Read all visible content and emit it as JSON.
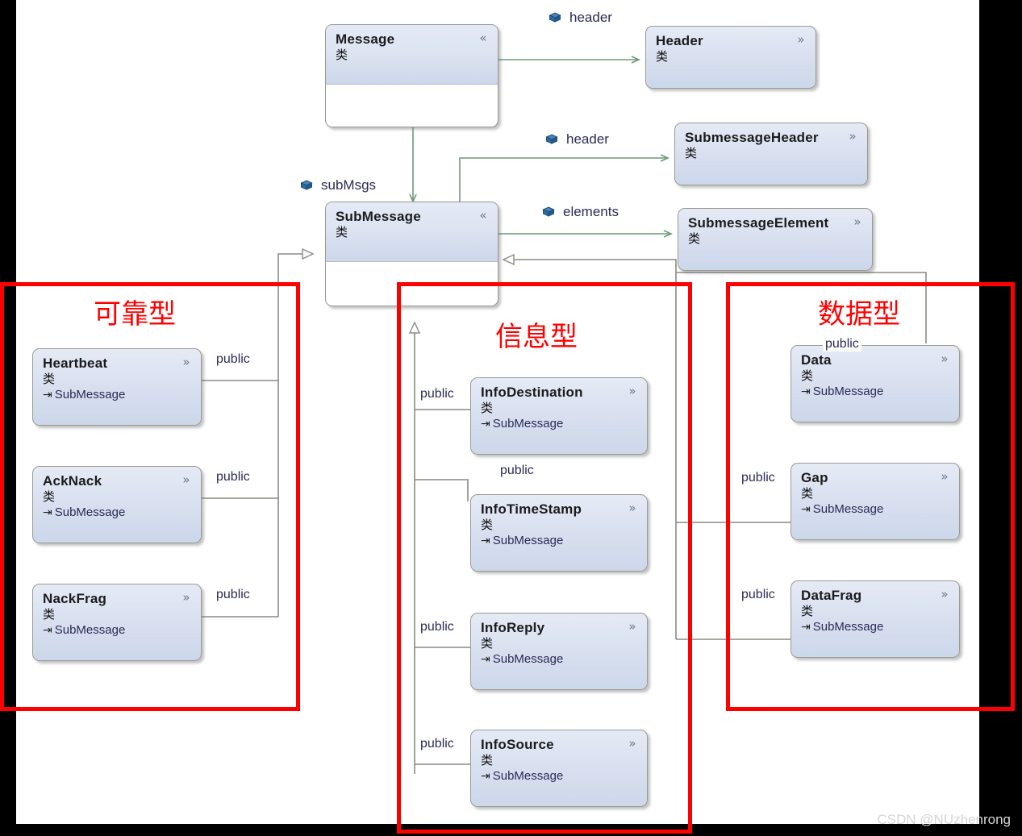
{
  "diagram": {
    "title": "RTPS Message UML class diagram",
    "class_kind_glyph": "类",
    "base_arrow_glyph": "⇥",
    "chevron_up": "«",
    "chevron_down": "»",
    "watermark": "CSDN @NUzhenrong"
  },
  "colors": {
    "group_red": "#ff0000",
    "association_green": "#6f9a7a",
    "inheritance_gray": "#8a8a84",
    "class_fill_top": "#e5eaf5",
    "class_fill_bottom": "#ccd7ea",
    "canvas_black": "#000000",
    "surface_white": "#ffffff"
  },
  "classes": [
    {
      "id": "message",
      "name": "Message",
      "kind": "类",
      "base": null,
      "state": "expanded",
      "chevron": "up"
    },
    {
      "id": "header",
      "name": "Header",
      "kind": "类",
      "base": null,
      "state": "collapsed",
      "chevron": "down"
    },
    {
      "id": "submessageheader",
      "name": "SubmessageHeader",
      "kind": "类",
      "base": null,
      "state": "collapsed",
      "chevron": "down"
    },
    {
      "id": "submessageelement",
      "name": "SubmessageElement",
      "kind": "类",
      "base": null,
      "state": "collapsed",
      "chevron": "down"
    },
    {
      "id": "submessage",
      "name": "SubMessage",
      "kind": "类",
      "base": null,
      "state": "expanded",
      "chevron": "up"
    },
    {
      "id": "heartbeat",
      "name": "Heartbeat",
      "kind": "类",
      "base": "SubMessage",
      "state": "collapsed",
      "chevron": "down"
    },
    {
      "id": "acknack",
      "name": "AckNack",
      "kind": "类",
      "base": "SubMessage",
      "state": "collapsed",
      "chevron": "down"
    },
    {
      "id": "nackfrag",
      "name": "NackFrag",
      "kind": "类",
      "base": "SubMessage",
      "state": "collapsed",
      "chevron": "down"
    },
    {
      "id": "infodestination",
      "name": "InfoDestination",
      "kind": "类",
      "base": "SubMessage",
      "state": "collapsed",
      "chevron": "down"
    },
    {
      "id": "infotimestamp",
      "name": "InfoTimeStamp",
      "kind": "类",
      "base": "SubMessage",
      "state": "collapsed",
      "chevron": "down"
    },
    {
      "id": "inforeply",
      "name": "InfoReply",
      "kind": "类",
      "base": "SubMessage",
      "state": "collapsed",
      "chevron": "down"
    },
    {
      "id": "infosource",
      "name": "InfoSource",
      "kind": "类",
      "base": "SubMessage",
      "state": "collapsed",
      "chevron": "down"
    },
    {
      "id": "data",
      "name": "Data",
      "kind": "类",
      "base": "SubMessage",
      "state": "collapsed",
      "chevron": "down"
    },
    {
      "id": "gap",
      "name": "Gap",
      "kind": "类",
      "base": "SubMessage",
      "state": "collapsed",
      "chevron": "down"
    },
    {
      "id": "datafrag",
      "name": "DataFrag",
      "kind": "类",
      "base": "SubMessage",
      "state": "collapsed",
      "chevron": "down"
    }
  ],
  "associations": [
    {
      "id": "a1",
      "label": "header",
      "from": "message",
      "to": "header"
    },
    {
      "id": "a2",
      "label": "subMsgs",
      "from": "message",
      "to": "submessage"
    },
    {
      "id": "a3",
      "label": "header",
      "from": "submessage",
      "to": "submessageheader"
    },
    {
      "id": "a4",
      "label": "elements",
      "from": "submessage",
      "to": "submessageelement"
    }
  ],
  "inheritance_labels": [
    {
      "id": "p-heartbeat",
      "text": "public",
      "child": "heartbeat"
    },
    {
      "id": "p-acknack",
      "text": "public",
      "child": "acknack"
    },
    {
      "id": "p-nackfrag",
      "text": "public",
      "child": "nackfrag"
    },
    {
      "id": "p-infodestination",
      "text": "public",
      "child": "infodestination"
    },
    {
      "id": "p-infotimestamp",
      "text": "public",
      "child": "infotimestamp"
    },
    {
      "id": "p-inforeply",
      "text": "public",
      "child": "inforeply"
    },
    {
      "id": "p-infosource",
      "text": "public",
      "child": "infosource"
    },
    {
      "id": "p-data",
      "text": "public",
      "child": "data"
    },
    {
      "id": "p-gap",
      "text": "public",
      "child": "gap"
    },
    {
      "id": "p-datafrag",
      "text": "public",
      "child": "datafrag"
    }
  ],
  "groups": [
    {
      "id": "reliable",
      "label": "可靠型",
      "members": [
        "heartbeat",
        "acknack",
        "nackfrag"
      ]
    },
    {
      "id": "information",
      "label": "信息型",
      "members": [
        "infodestination",
        "infotimestamp",
        "inforeply",
        "infosource"
      ]
    },
    {
      "id": "data_group",
      "label": "数据型",
      "members": [
        "data",
        "gap",
        "datafrag"
      ]
    }
  ]
}
